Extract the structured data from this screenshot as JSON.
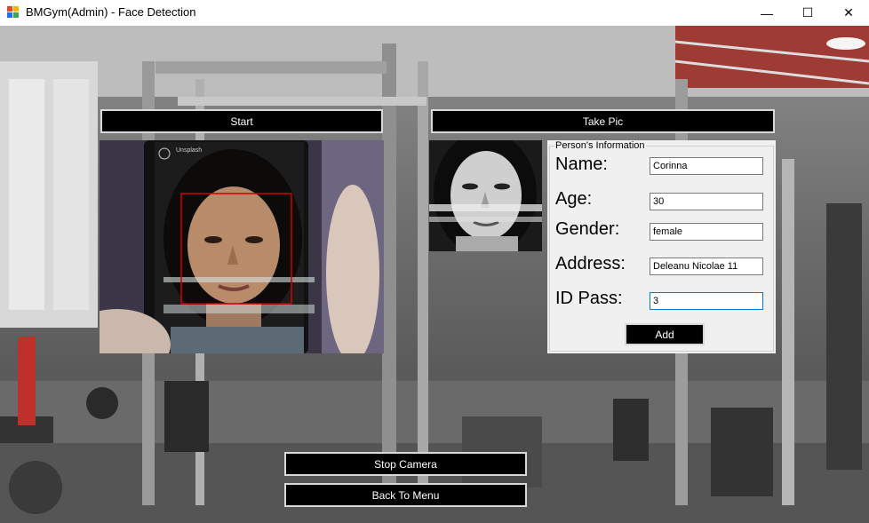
{
  "window": {
    "title": "BMGym(Admin) - Face Detection",
    "controls": {
      "minimize": "—",
      "maximize": "☐",
      "close": "✕"
    }
  },
  "buttons": {
    "start": "Start",
    "take_pic": "Take Pic",
    "stop_camera": "Stop Camera",
    "back_to_menu": "Back To Menu",
    "add": "Add"
  },
  "camera": {
    "overlay_text": "Unsplash"
  },
  "person_info": {
    "group_title": "Person's Information",
    "fields": [
      {
        "label": "Name:",
        "value": "Corinna"
      },
      {
        "label": "Age:",
        "value": "30"
      },
      {
        "label": "Gender:",
        "value": "female"
      },
      {
        "label": "Address:",
        "value": "Deleanu Nicolae 11"
      },
      {
        "label": "ID Pass:",
        "value": "3"
      }
    ]
  },
  "colors": {
    "button_bg": "#000000",
    "button_text": "#ffffff",
    "face_box": "#d40000",
    "focus_border": "#0078d7"
  }
}
